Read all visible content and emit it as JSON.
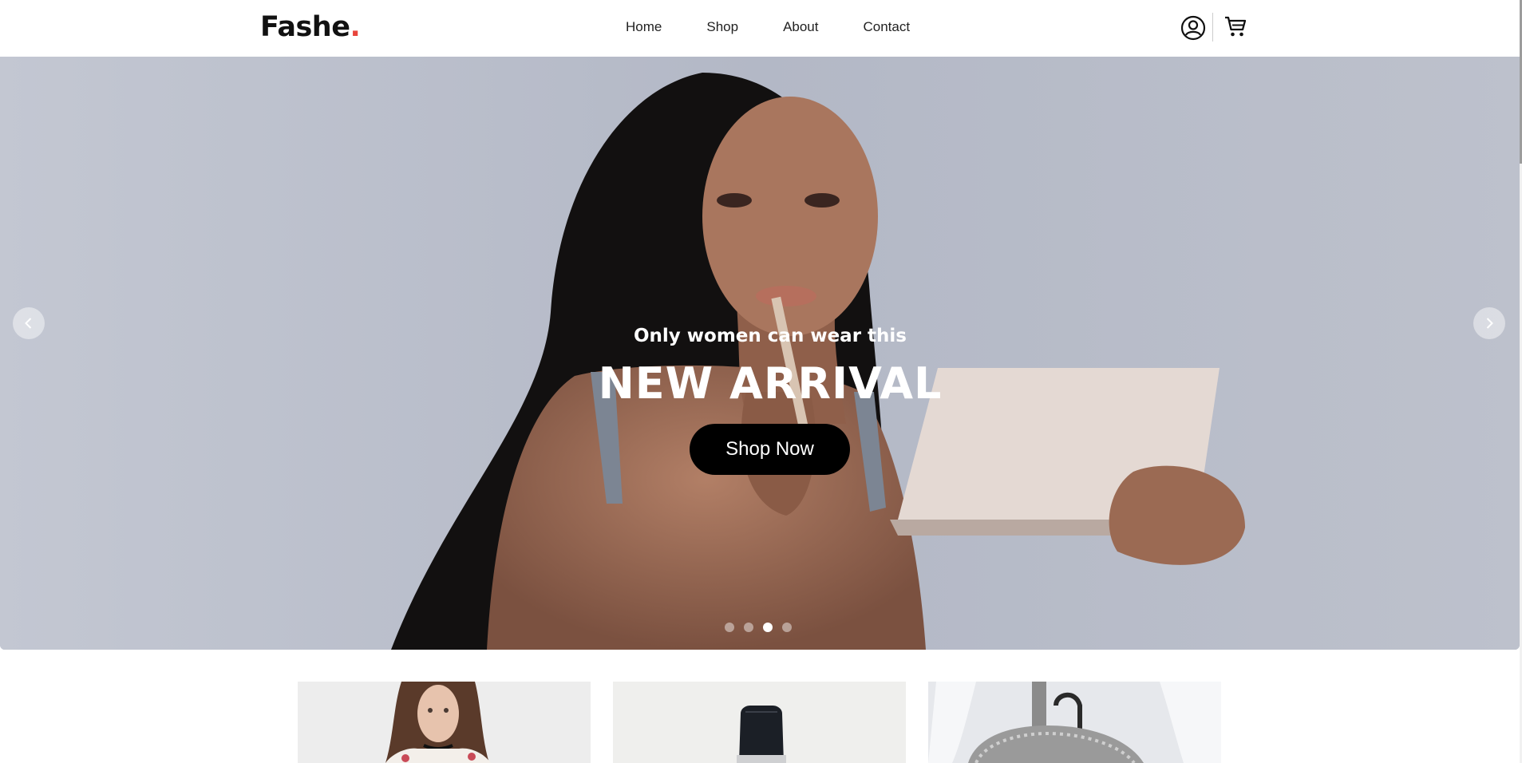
{
  "brand": {
    "name": "Fashe",
    "dot": "."
  },
  "nav": {
    "items": [
      "Home",
      "Shop",
      "About",
      "Contact"
    ]
  },
  "header_icons": [
    "user-icon",
    "cart-icon"
  ],
  "hero": {
    "subtitle": "Only women can wear this",
    "title": "NEW ARRIVAL",
    "cta": "Shop Now",
    "slide_count": 4,
    "active_slide": 3
  },
  "colors": {
    "accent": "#e8453c",
    "button": "#000000",
    "hero_bg": "#b7bccb"
  },
  "category_cards": [
    {
      "image": "woman-floral-dress-photo"
    },
    {
      "image": "watch-photo"
    },
    {
      "image": "backpack-photo"
    }
  ]
}
